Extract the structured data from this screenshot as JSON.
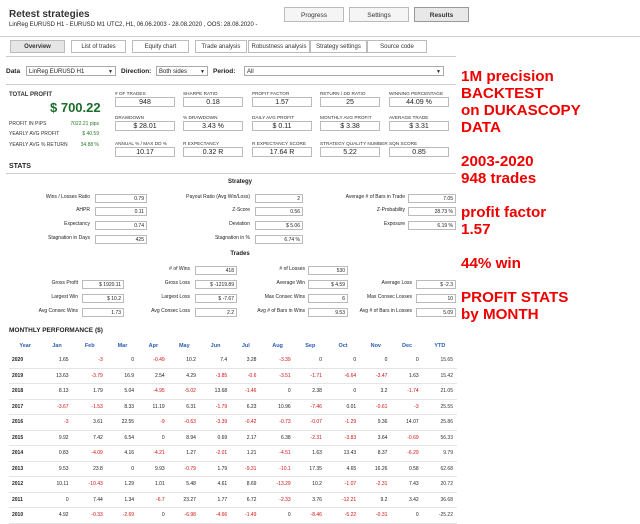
{
  "header": {
    "title": "Retest strategies",
    "subtitle": "LinReg EURUSD H1 - EURUSD  M1  UTC2, H1, 06.06.2003 - 28.08.2020 , OOS: 28.08.2020 -",
    "buttons": [
      "Progress",
      "Settings",
      "Results"
    ]
  },
  "tabs": [
    "Overview",
    "List of trades",
    "Equity chart",
    "Trade analysis",
    "Robustness analysis",
    "Strategy settings",
    "Source code"
  ],
  "filters": {
    "data_label": "Data",
    "data_value": "LinReg EURUSD H1",
    "direction_label": "Direction:",
    "direction_value": "Both sides",
    "period_label": "Period:",
    "period_value": "All"
  },
  "summary": {
    "total_profit_label": "TOTAL PROFIT",
    "total_profit_value": "$ 700.22",
    "profit_pips_label": "PROFIT IN PIPS",
    "profit_pips_value": "7022.21 pips",
    "yearly_avg_label": "YEARLY AVG PROFIT",
    "yearly_avg_value": "$ 40.59",
    "yearly_ret_label": "YEARLY AVG % RETURN",
    "yearly_ret_value": "34.88 %"
  },
  "metrics": [
    {
      "label": "# OF TRADES",
      "value": "948"
    },
    {
      "label": "SHARPE RATIO",
      "value": "0.18"
    },
    {
      "label": "PROFIT FACTOR",
      "value": "1.57"
    },
    {
      "label": "RETURN / DD RATIO",
      "value": "25"
    },
    {
      "label": "WINNING PERCENTAGE",
      "value": "44.09 %"
    },
    {
      "label": "DRAWDOWN",
      "value": "$ 28.01"
    },
    {
      "label": "% DRAWDOWN",
      "value": "3.43 %"
    },
    {
      "label": "DAILY AVG PROFIT",
      "value": "$ 0.11"
    },
    {
      "label": "MONTHLY AVG PROFIT",
      "value": "$ 3.38"
    },
    {
      "label": "AVERAGE TRADE",
      "value": "$ 3.31"
    },
    {
      "label": "ANNUAL % / MAX DD %",
      "value": "10.17"
    },
    {
      "label": "R EXPECTANCY",
      "value": "0.32 R"
    },
    {
      "label": "R EXPECTANCY SCORE",
      "value": "17.64 R"
    },
    {
      "label": "STRATEGY QUALITY NUMBER",
      "value": "5.22"
    },
    {
      "label": "SQN SCORE",
      "value": "0.85"
    }
  ],
  "stats_heading": "STATS",
  "strategy_title": "Strategy",
  "strategy_rows": [
    [
      {
        "label": "Wins / Losses Ratio",
        "value": "0.79"
      },
      {
        "label": "Payout Ratio (Avg Win/Loss)",
        "value": "2"
      },
      {
        "label": "Average # of Bars in Trade",
        "value": "7.05"
      }
    ],
    [
      {
        "label": "AHPR",
        "value": "0.11"
      },
      {
        "label": "Z-Score",
        "value": "0.56"
      },
      {
        "label": "Z-Probability",
        "value": "28.73 %"
      }
    ],
    [
      {
        "label": "Expectancy",
        "value": "0.74"
      },
      {
        "label": "Deviation",
        "value": "$ 5.06"
      },
      {
        "label": "Exposure",
        "value": "6.19 %"
      }
    ],
    [
      {
        "label": "Stagnation in Days",
        "value": "425"
      },
      {
        "label": "Stagnation in %",
        "value": "6.74 %"
      },
      {
        "label": "",
        "value": ""
      }
    ]
  ],
  "trades_title": "Trades",
  "trades_rows": [
    [
      {
        "label": "",
        "value": ""
      },
      {
        "label": "# of Wins",
        "value": "418"
      },
      {
        "label": "# of Losses",
        "value": "530"
      }
    ],
    [
      {
        "label": "Gross Profit",
        "value": "$ 1920.11"
      },
      {
        "label": "Gross Loss",
        "value": "$ -1219.89"
      },
      {
        "label": "Average Win",
        "value": "$ 4.59"
      },
      {
        "label": "Average Loss",
        "value": "$ -2.3"
      }
    ],
    [
      {
        "label": "Largest Win",
        "value": "$ 10.2"
      },
      {
        "label": "Largest Loss",
        "value": "$ -7.67"
      },
      {
        "label": "Max Consec Wins",
        "value": "6"
      },
      {
        "label": "Max Consec Losses",
        "value": "10"
      }
    ],
    [
      {
        "label": "Avg Consec Wins",
        "value": "1.73"
      },
      {
        "label": "Avg Consec Loss",
        "value": "2.2"
      },
      {
        "label": "Avg # of Bars in Wins",
        "value": "9.53"
      },
      {
        "label": "Avg # of Bars in Losses",
        "value": "5.09"
      }
    ]
  ],
  "monthly_heading": "MONTHLY PERFORMANCE ($)",
  "monthly_columns": [
    "Year",
    "Jan",
    "Feb",
    "Mar",
    "Apr",
    "May",
    "Jun",
    "Jul",
    "Aug",
    "Sep",
    "Oct",
    "Nov",
    "Dec",
    "YTD"
  ],
  "monthly_rows": [
    [
      "2020",
      "1.65",
      "-3",
      "0",
      "-0.49",
      "10.2",
      "7.4",
      "3.28",
      "-3.39",
      "0",
      "0",
      "0",
      "0",
      "15.65"
    ],
    [
      "2019",
      "13.63",
      "-3.79",
      "16.9",
      "2.54",
      "4.29",
      "-3.85",
      "-0.6",
      "-3.51",
      "-1.71",
      "-6.64",
      "-3.47",
      "1.63",
      "15.42"
    ],
    [
      "2018",
      "8.13",
      "1.79",
      "5.04",
      "-4.95",
      "-5.02",
      "13.68",
      "-1.46",
      "0",
      "2.38",
      "0",
      "3.2",
      "-1.74",
      "21.05"
    ],
    [
      "2017",
      "-3.67",
      "-1.53",
      "8.33",
      "11.19",
      "6.31",
      "-1.79",
      "6.23",
      "10.96",
      "-7.46",
      "0.01",
      "-0.61",
      "-3",
      "25.55"
    ],
    [
      "2016",
      "-3",
      "3.61",
      "22.55",
      "-9",
      "-0.63",
      "-3.39",
      "-0.42",
      "-0.73",
      "-0.07",
      "-1.29",
      "9.36",
      "14.07",
      "25.86"
    ],
    [
      "2015",
      "9.92",
      "7.42",
      "6.54",
      "0",
      "8.94",
      "0.69",
      "2.17",
      "6.38",
      "-2.31",
      "-3.83",
      "3.64",
      "-0.69",
      "56.33"
    ],
    [
      "2014",
      "0.83",
      "-4.09",
      "4.16",
      "-4.21",
      "1.27",
      "-2.01",
      "1.21",
      "-4.51",
      "1.63",
      "13.43",
      "8.37",
      "-6.29",
      "9.79"
    ],
    [
      "2013",
      "9.53",
      "23.8",
      "0",
      "9.93",
      "-0.79",
      "1.79",
      "-9.31",
      "-10.1",
      "17.35",
      "4.65",
      "16.26",
      "0.58",
      "62.68"
    ],
    [
      "2012",
      "10.11",
      "-10.43",
      "1.29",
      "1.01",
      "5.48",
      "4.61",
      "8.69",
      "-13.29",
      "10.2",
      "-1.07",
      "-2.31",
      "7.43",
      "20.72"
    ],
    [
      "2011",
      "0",
      "7.44",
      "1.34",
      "-6.7",
      "23.27",
      "1.77",
      "6.72",
      "-2.33",
      "3.76",
      "-12.21",
      "9.2",
      "3.42",
      "36.68"
    ],
    [
      "2010",
      "4.92",
      "-0.33",
      "-2.69",
      "0",
      "-6.98",
      "-4.66",
      "-1.49",
      "0",
      "-8.46",
      "-5.22",
      "-0.31",
      "0",
      "-25.22"
    ]
  ],
  "overlay": [
    "1M precision",
    "BACKTEST",
    "on DUKASCOPY",
    "DATA",
    "",
    "2003-2020",
    "948 trades",
    "",
    "profit factor",
    "1.57",
    "",
    "44% win",
    "",
    "PROFIT STATS",
    "by MONTH"
  ],
  "colors": {
    "positive": "#1a6e2a",
    "negative": "#d01010",
    "overlay": "#ee0000",
    "year_header": "#2a5db0"
  }
}
